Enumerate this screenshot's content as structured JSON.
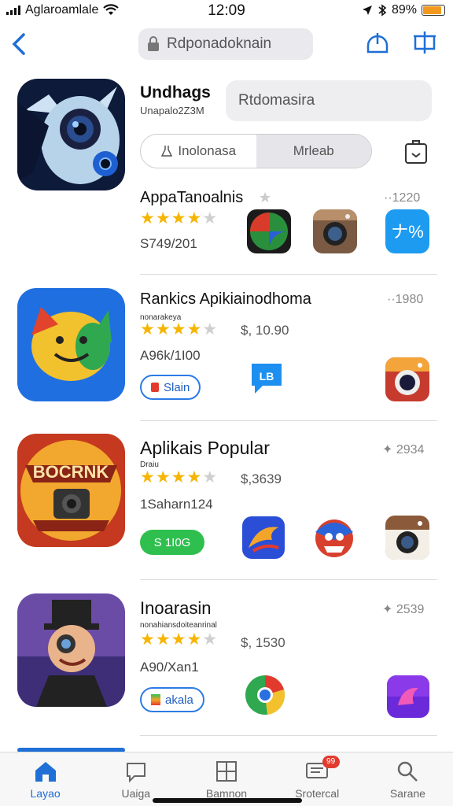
{
  "status_bar": {
    "carrier": "Aglaroamlale",
    "time": "12:09",
    "battery_percent": "89%",
    "battery_level": 0.89
  },
  "header": {
    "search_text": "Rdponadoknain"
  },
  "featured": {
    "title": "Undhags",
    "subtitle": "Unapalo2Z3M",
    "field_text": "Rtdomasira",
    "segment_left": "Inolonasa",
    "segment_right": "Mrleab"
  },
  "rows": [
    {
      "title": "AppaTanoalnis",
      "meta": "1220",
      "rating": 4.5,
      "sub": "S749/201"
    },
    {
      "title": "Rankics Apikiainodhoma",
      "meta": "1980",
      "small": "nonarakeya",
      "rating": 4.5,
      "price": "$, 10.90",
      "sub": "A96k/1I00",
      "chip": "Slain"
    },
    {
      "title": "Aplikais Popular",
      "meta": "2934",
      "small": "Draiu",
      "rating": 4.5,
      "price": "$,3639",
      "sub": "1Saharn124",
      "chip": "S 1I0G"
    },
    {
      "title": "Inoarasin",
      "meta": "2539",
      "small": "nonahiansdoiteanrinal",
      "rating": 4.5,
      "price": "$, 1530",
      "sub": "A90/Xan1",
      "chip": "akala"
    }
  ],
  "tabbar": {
    "tabs": [
      {
        "label": "Layao",
        "icon": "home-icon"
      },
      {
        "label": "Uaiga",
        "icon": "chat-icon"
      },
      {
        "label": "Bamnon",
        "icon": "grid-icon"
      },
      {
        "label": "Srotercal",
        "icon": "message-icon",
        "badge": "99"
      },
      {
        "label": "Sarane",
        "icon": "search-icon"
      }
    ]
  },
  "colors": {
    "accent": "#1f6fd6",
    "star": "#f6b500",
    "green": "#2fbf4f"
  }
}
